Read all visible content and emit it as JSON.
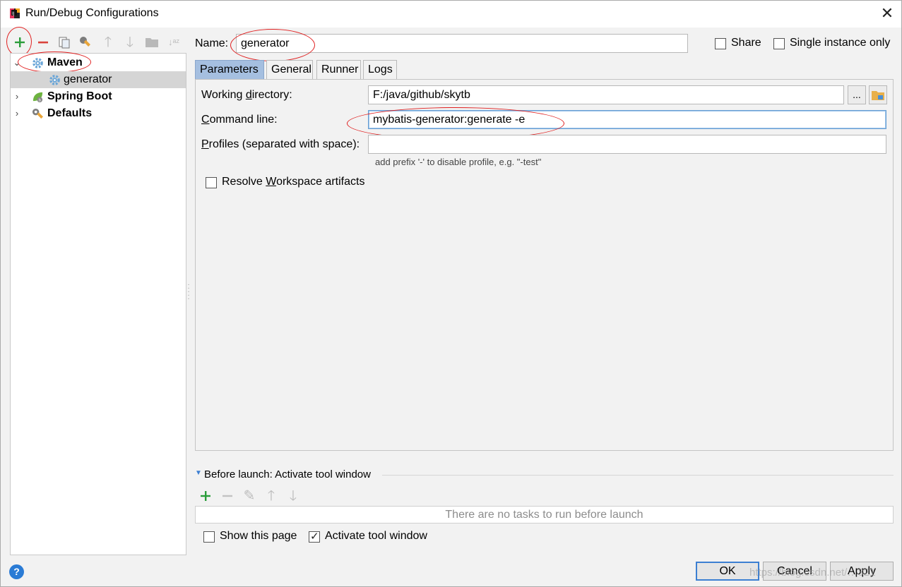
{
  "window": {
    "title": "Run/Debug Configurations"
  },
  "tree": {
    "items": [
      {
        "label": "Maven",
        "expanded": true
      },
      {
        "label": "generator",
        "selected": true
      },
      {
        "label": "Spring Boot",
        "expanded": false
      },
      {
        "label": "Defaults",
        "expanded": false
      }
    ]
  },
  "form": {
    "name_label": "Name:",
    "name_value": "generator",
    "share_label": "Share",
    "single_instance_label": "Single instance only",
    "tabs": [
      "Parameters",
      "General",
      "Runner",
      "Logs"
    ],
    "active_tab": "Parameters",
    "working_dir_label": "Working directory:",
    "working_dir_value": "F:/java/github/skytb",
    "browse_label": "...",
    "command_line_label": "Command line:",
    "command_line_value": "mybatis-generator:generate -e",
    "profiles_label": "Profiles (separated with space):",
    "profiles_value": "",
    "profiles_hint": "add prefix '-' to disable profile, e.g. \"-test\"",
    "resolve_label": "Resolve Workspace artifacts"
  },
  "before_launch": {
    "header": "Before launch: Activate tool window",
    "empty_text": "There are no tasks to run before launch",
    "show_page_label": "Show this page",
    "activate_label": "Activate tool window"
  },
  "buttons": {
    "ok": "OK",
    "cancel": "Cancel",
    "apply": "Apply",
    "help": "?"
  },
  "watermark": "https://blog.csdn.net/…321",
  "colors": {
    "accent": "#3c7fd2",
    "annotation": "#e02020",
    "add": "#2a9d3a",
    "remove": "#d9423b",
    "tab_active": "#a5bfe0"
  }
}
